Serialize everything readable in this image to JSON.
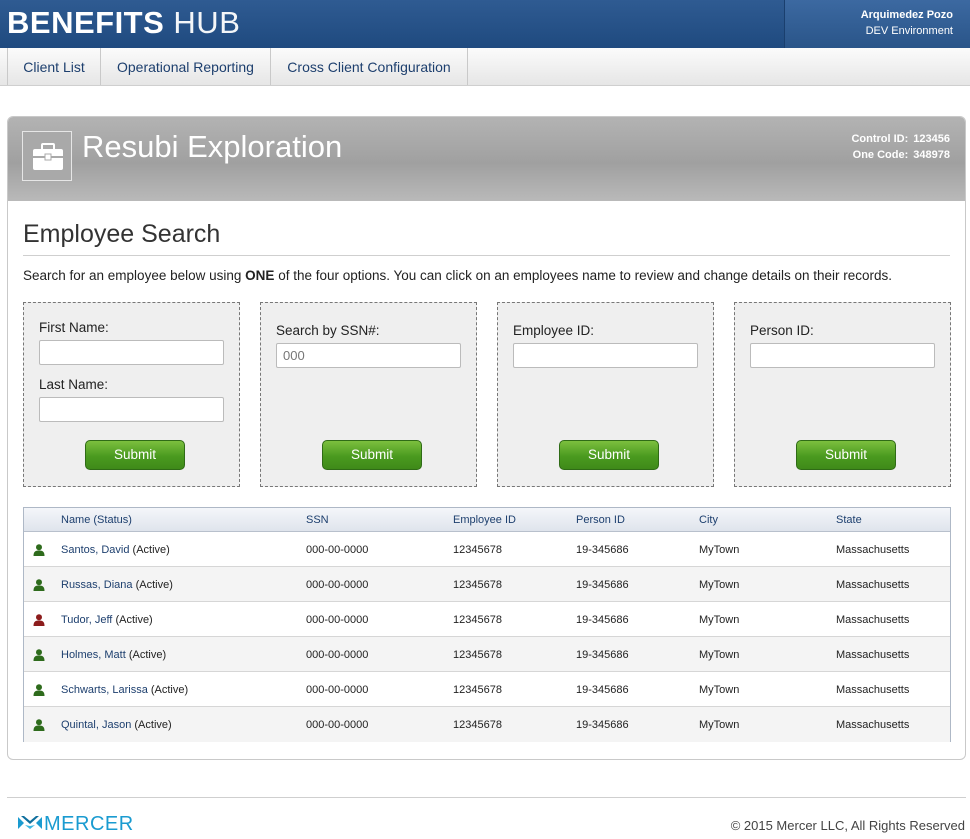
{
  "header": {
    "brand_bold": "BENEFITS",
    "brand_light": "HUB",
    "user_name": "Arquimedez Pozo",
    "environment": "DEV Environment"
  },
  "nav": {
    "tabs": [
      {
        "label": "Client List"
      },
      {
        "label": "Operational Reporting"
      },
      {
        "label": "Cross Client Configuration"
      }
    ]
  },
  "client": {
    "name": "Resubi Exploration",
    "control_id_label": "Control ID:",
    "control_id": "123456",
    "one_code_label": "One Code:",
    "one_code": "348978"
  },
  "search": {
    "title": "Employee Search",
    "intro_before": "Search for an employee below using",
    "intro_bold": "ONE",
    "intro_after": "of the four options. You can click on an employees name to review and change details on their records.",
    "first_name_label": "First Name:",
    "last_name_label": "Last Name:",
    "ssn_label": "Search by SSN#:",
    "ssn_placeholder": "000",
    "employee_id_label": "Employee ID:",
    "person_id_label": "Person ID:",
    "submit_label": "Submit"
  },
  "table": {
    "columns": [
      "Name (Status)",
      "SSN",
      "Employee ID",
      "Person ID",
      "City",
      "State"
    ],
    "rows": [
      {
        "name": "Santos, David",
        "status": "(Active)",
        "ssn": "000-00-0000",
        "employee_id": "12345678",
        "person_id": "19-345686",
        "city": "MyTown",
        "state": "Massachusetts",
        "icon_color": "#2e6b1c"
      },
      {
        "name": "Russas, Diana",
        "status": "(Active)",
        "ssn": "000-00-0000",
        "employee_id": "12345678",
        "person_id": "19-345686",
        "city": "MyTown",
        "state": "Massachusetts",
        "icon_color": "#2e6b1c"
      },
      {
        "name": "Tudor, Jeff",
        "status": "(Active)",
        "ssn": "000-00-0000",
        "employee_id": "12345678",
        "person_id": "19-345686",
        "city": "MyTown",
        "state": "Massachusetts",
        "icon_color": "#8c1c1c"
      },
      {
        "name": "Holmes, Matt",
        "status": "(Active)",
        "ssn": "000-00-0000",
        "employee_id": "12345678",
        "person_id": "19-345686",
        "city": "MyTown",
        "state": "Massachusetts",
        "icon_color": "#2e6b1c"
      },
      {
        "name": "Schwarts, Larissa",
        "status": "(Active)",
        "ssn": "000-00-0000",
        "employee_id": "12345678",
        "person_id": "19-345686",
        "city": "MyTown",
        "state": "Massachusetts",
        "icon_color": "#2e6b1c"
      },
      {
        "name": "Quintal, Jason",
        "status": "(Active)",
        "ssn": "000-00-0000",
        "employee_id": "12345678",
        "person_id": "19-345686",
        "city": "MyTown",
        "state": "Massachusetts",
        "icon_color": "#2e6b1c"
      }
    ]
  },
  "footer": {
    "logo_text": "MERCER",
    "copyright": "© 2015 Mercer LLC, All Rights Reserved"
  }
}
